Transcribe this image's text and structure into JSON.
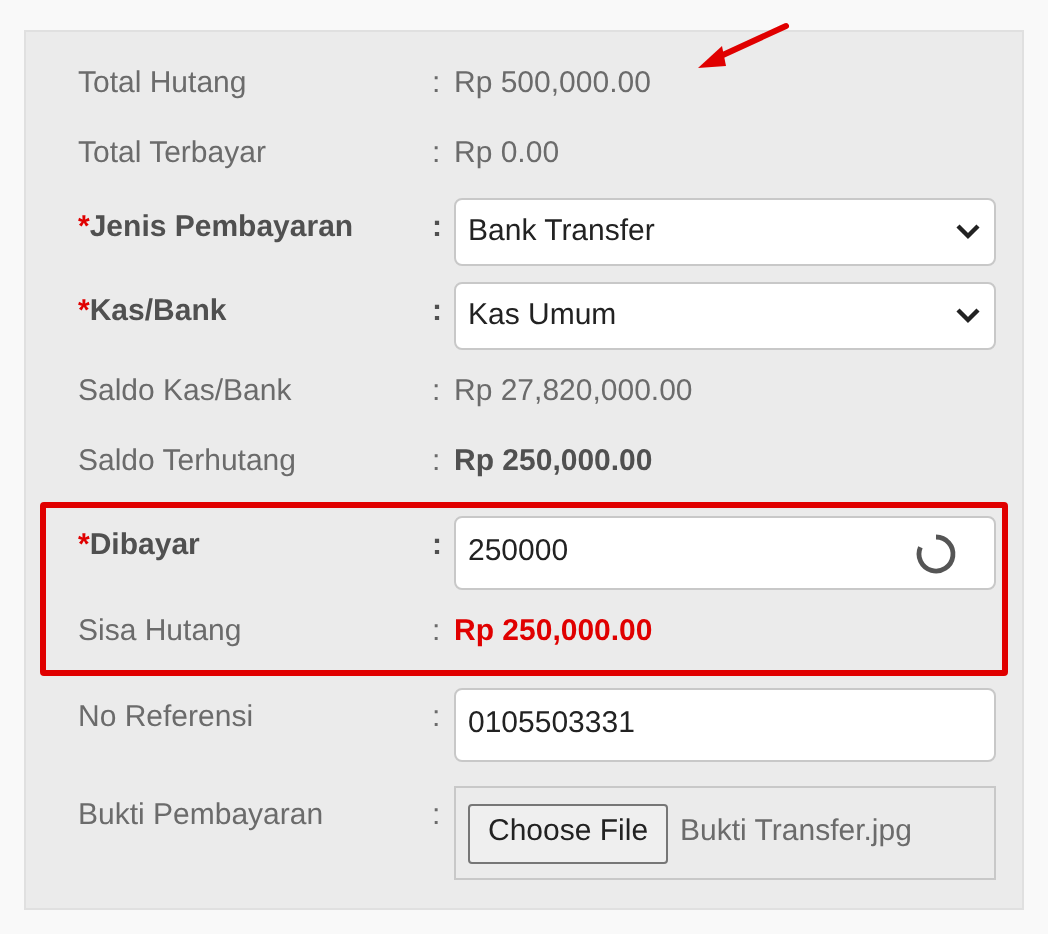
{
  "rows": [
    {
      "kind": "text",
      "label": "Total Hutang",
      "required": false,
      "value": "Rp 500,000.00",
      "bold": false,
      "alert": false,
      "highlighted": false,
      "annotated": true
    },
    {
      "kind": "text",
      "label": "Total Terbayar",
      "required": false,
      "value": "Rp 0.00",
      "bold": false,
      "alert": false,
      "highlighted": false,
      "annotated": false
    },
    {
      "kind": "select",
      "label": "Jenis Pembayaran",
      "required": true,
      "value": "Bank Transfer",
      "highlighted": false,
      "annotated": false
    },
    {
      "kind": "select",
      "label": "Kas/Bank",
      "required": true,
      "value": "Kas Umum",
      "highlighted": false,
      "annotated": false
    },
    {
      "kind": "text",
      "label": "Saldo Kas/Bank",
      "required": false,
      "value": "Rp 27,820,000.00",
      "bold": false,
      "alert": false,
      "highlighted": false,
      "annotated": false
    },
    {
      "kind": "text",
      "label": "Saldo Terhutang",
      "required": false,
      "value": "Rp 250,000.00",
      "bold": true,
      "alert": false,
      "highlighted": false,
      "annotated": false
    },
    {
      "kind": "input",
      "label": "Dibayar",
      "required": true,
      "value": "250000",
      "loading": true,
      "highlighted": true,
      "annotated": false
    },
    {
      "kind": "text",
      "label": "Sisa Hutang",
      "required": false,
      "value": "Rp 250,000.00",
      "bold": true,
      "alert": true,
      "highlighted": true,
      "annotated": false
    },
    {
      "kind": "input",
      "label": "No Referensi",
      "required": false,
      "value": "0105503331",
      "loading": false,
      "highlighted": false,
      "annotated": false
    },
    {
      "kind": "file",
      "label": "Bukti Pembayaran",
      "required": false,
      "button": "Choose File",
      "value": "Bukti Transfer.jpg",
      "highlighted": false,
      "annotated": false
    }
  ],
  "required_mark": "*",
  "separator": ":"
}
